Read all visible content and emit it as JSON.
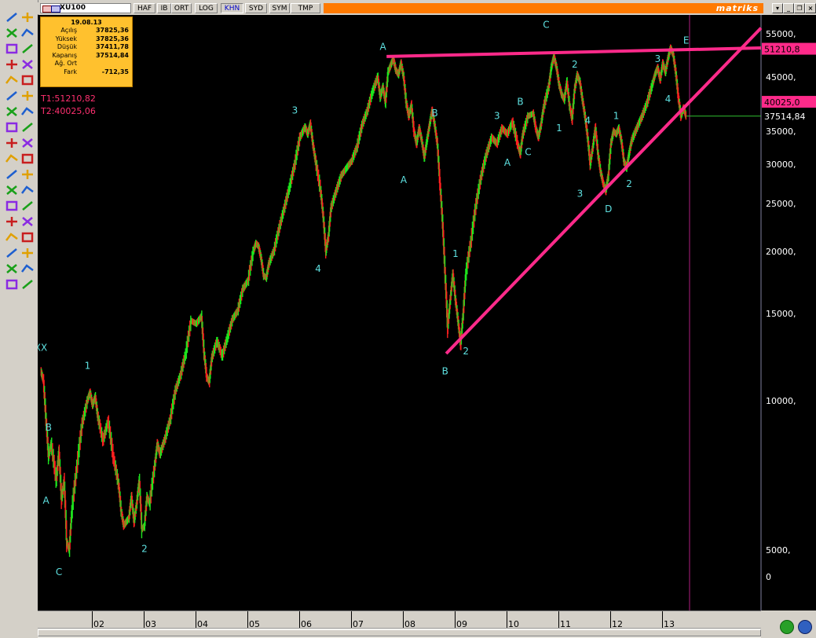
{
  "window": {
    "symbol": "XU100",
    "tabs": [
      "HAF",
      "IB",
      "ORT",
      "LOG",
      "KHN",
      "SYD",
      "SYM",
      "TMP"
    ],
    "active_tab": "KHN",
    "brand": "matriks",
    "controls": [
      "▾",
      "_",
      "❐",
      "×"
    ]
  },
  "info_box": {
    "date": "19.08.13",
    "rows": [
      {
        "label": "Açılış",
        "value": "37825,36"
      },
      {
        "label": "Yüksek",
        "value": "37825,36"
      },
      {
        "label": "Düşük",
        "value": "37411,78"
      },
      {
        "label": "Kapanış",
        "value": "37514,84"
      },
      {
        "label": "Ağ. Ort",
        "value": ""
      },
      {
        "label": "Fark",
        "value": "-712,35"
      }
    ]
  },
  "trendline_labels": {
    "t1": "T1:51210,82",
    "t2": "T2:40025,06"
  },
  "colors": {
    "up_bar": "#1ee61e",
    "down_bar": "#ff2020",
    "trendline": "#ff2a8a",
    "wave_label": "#5ee0e0",
    "axis_text": "#ffffff",
    "background": "#000000",
    "orange_brand": "#ff7a00"
  },
  "chart_data": {
    "type": "line",
    "instrument": "XU100",
    "y_scale": "log",
    "y_ticks": [
      "55000,",
      "45000,",
      "40000,",
      "35000,",
      "30000,",
      "25000,",
      "20000,",
      "15000,",
      "10000,",
      "5000,",
      "0"
    ],
    "x_ticks": [
      "02",
      "03",
      "04",
      "05",
      "06",
      "07",
      "08",
      "09",
      "10",
      "11",
      "12",
      "13"
    ],
    "price_flags": {
      "t1": "51210,8",
      "t2": "40025,0",
      "last": "37514,84"
    },
    "series": [
      {
        "values": [
          [
            2001.0,
            11500
          ],
          [
            2001.05,
            11000
          ],
          [
            2001.1,
            9200
          ],
          [
            2001.15,
            7700
          ],
          [
            2001.2,
            8200
          ],
          [
            2001.3,
            6900
          ],
          [
            2001.35,
            7900
          ],
          [
            2001.4,
            6300
          ],
          [
            2001.45,
            6900
          ],
          [
            2001.5,
            5200
          ],
          [
            2001.55,
            5000
          ],
          [
            2001.6,
            6000
          ],
          [
            2001.7,
            7400
          ],
          [
            2001.8,
            9000
          ],
          [
            2001.9,
            10000
          ],
          [
            2001.95,
            10400
          ],
          [
            2002.0,
            9800
          ],
          [
            2002.05,
            10200
          ],
          [
            2002.1,
            9300
          ],
          [
            2002.2,
            8300
          ],
          [
            2002.3,
            9100
          ],
          [
            2002.4,
            7700
          ],
          [
            2002.5,
            6800
          ],
          [
            2002.55,
            6000
          ],
          [
            2002.6,
            5600
          ],
          [
            2002.7,
            5800
          ],
          [
            2002.75,
            6400
          ],
          [
            2002.8,
            5700
          ],
          [
            2002.85,
            6200
          ],
          [
            2002.9,
            6900
          ],
          [
            2002.95,
            5500
          ],
          [
            2003.0,
            5600
          ],
          [
            2003.05,
            6400
          ],
          [
            2003.1,
            6200
          ],
          [
            2003.2,
            7400
          ],
          [
            2003.25,
            8200
          ],
          [
            2003.3,
            7800
          ],
          [
            2003.4,
            8400
          ],
          [
            2003.5,
            9200
          ],
          [
            2003.6,
            10500
          ],
          [
            2003.7,
            11300
          ],
          [
            2003.8,
            12500
          ],
          [
            2003.9,
            14500
          ],
          [
            2004.0,
            14300
          ],
          [
            2004.1,
            14800
          ],
          [
            2004.15,
            12500
          ],
          [
            2004.2,
            11200
          ],
          [
            2004.25,
            10900
          ],
          [
            2004.3,
            12200
          ],
          [
            2004.4,
            13200
          ],
          [
            2004.5,
            12300
          ],
          [
            2004.6,
            13400
          ],
          [
            2004.7,
            14600
          ],
          [
            2004.8,
            15200
          ],
          [
            2004.9,
            16800
          ],
          [
            2005.0,
            17500
          ],
          [
            2005.1,
            20000
          ],
          [
            2005.15,
            20800
          ],
          [
            2005.2,
            20500
          ],
          [
            2005.25,
            19400
          ],
          [
            2005.3,
            17900
          ],
          [
            2005.35,
            17700
          ],
          [
            2005.4,
            18900
          ],
          [
            2005.5,
            20100
          ],
          [
            2005.6,
            22300
          ],
          [
            2005.7,
            24500
          ],
          [
            2005.8,
            27000
          ],
          [
            2005.9,
            30000
          ],
          [
            2006.0,
            34000
          ],
          [
            2006.1,
            35700
          ],
          [
            2006.15,
            34500
          ],
          [
            2006.2,
            36200
          ],
          [
            2006.25,
            33000
          ],
          [
            2006.3,
            30500
          ],
          [
            2006.4,
            26500
          ],
          [
            2006.45,
            23500
          ],
          [
            2006.5,
            20000
          ],
          [
            2006.55,
            21500
          ],
          [
            2006.6,
            24500
          ],
          [
            2006.7,
            26500
          ],
          [
            2006.8,
            28500
          ],
          [
            2006.9,
            29500
          ],
          [
            2007.0,
            30500
          ],
          [
            2007.1,
            32500
          ],
          [
            2007.2,
            36000
          ],
          [
            2007.3,
            38500
          ],
          [
            2007.4,
            42000
          ],
          [
            2007.5,
            45000
          ],
          [
            2007.55,
            41000
          ],
          [
            2007.6,
            43000
          ],
          [
            2007.65,
            40000
          ],
          [
            2007.7,
            46000
          ],
          [
            2007.75,
            47500
          ],
          [
            2007.8,
            49000
          ],
          [
            2007.85,
            46500
          ],
          [
            2007.9,
            45500
          ],
          [
            2007.95,
            48000
          ],
          [
            2008.0,
            45000
          ],
          [
            2008.05,
            40000
          ],
          [
            2008.1,
            37500
          ],
          [
            2008.15,
            39500
          ],
          [
            2008.2,
            35000
          ],
          [
            2008.25,
            33000
          ],
          [
            2008.3,
            35500
          ],
          [
            2008.35,
            33500
          ],
          [
            2008.4,
            31000
          ],
          [
            2008.45,
            33500
          ],
          [
            2008.5,
            36000
          ],
          [
            2008.55,
            38500
          ],
          [
            2008.6,
            36000
          ],
          [
            2008.65,
            33000
          ],
          [
            2008.7,
            27500
          ],
          [
            2008.75,
            23000
          ],
          [
            2008.8,
            18000
          ],
          [
            2008.85,
            14000
          ],
          [
            2008.9,
            16000
          ],
          [
            2008.95,
            18000
          ],
          [
            2009.0,
            16000
          ],
          [
            2009.05,
            14500
          ],
          [
            2009.1,
            13000
          ],
          [
            2009.15,
            15000
          ],
          [
            2009.2,
            18000
          ],
          [
            2009.3,
            21000
          ],
          [
            2009.4,
            25000
          ],
          [
            2009.5,
            28500
          ],
          [
            2009.6,
            31500
          ],
          [
            2009.7,
            34000
          ],
          [
            2009.8,
            33000
          ],
          [
            2009.9,
            35500
          ],
          [
            2010.0,
            34500
          ],
          [
            2010.1,
            36500
          ],
          [
            2010.2,
            33000
          ],
          [
            2010.25,
            31500
          ],
          [
            2010.3,
            34500
          ],
          [
            2010.4,
            37500
          ],
          [
            2010.5,
            38000
          ],
          [
            2010.55,
            35500
          ],
          [
            2010.6,
            34000
          ],
          [
            2010.65,
            36000
          ],
          [
            2010.7,
            39000
          ],
          [
            2010.8,
            43000
          ],
          [
            2010.85,
            47000
          ],
          [
            2010.9,
            49500
          ],
          [
            2010.95,
            47000
          ],
          [
            2011.0,
            43500
          ],
          [
            2011.05,
            41500
          ],
          [
            2011.1,
            40500
          ],
          [
            2011.15,
            44000
          ],
          [
            2011.2,
            39500
          ],
          [
            2011.25,
            37000
          ],
          [
            2011.3,
            42500
          ],
          [
            2011.35,
            45500
          ],
          [
            2011.4,
            44000
          ],
          [
            2011.45,
            40500
          ],
          [
            2011.5,
            37500
          ],
          [
            2011.55,
            34000
          ],
          [
            2011.6,
            30000
          ],
          [
            2011.65,
            32500
          ],
          [
            2011.7,
            35500
          ],
          [
            2011.75,
            31500
          ],
          [
            2011.8,
            29000
          ],
          [
            2011.85,
            27500
          ],
          [
            2011.9,
            26500
          ],
          [
            2011.95,
            28500
          ],
          [
            2012.0,
            33000
          ],
          [
            2012.05,
            35000
          ],
          [
            2012.1,
            34500
          ],
          [
            2012.15,
            35500
          ],
          [
            2012.2,
            33500
          ],
          [
            2012.25,
            30500
          ],
          [
            2012.3,
            29500
          ],
          [
            2012.35,
            31500
          ],
          [
            2012.4,
            33500
          ],
          [
            2012.5,
            35500
          ],
          [
            2012.6,
            37500
          ],
          [
            2012.7,
            40000
          ],
          [
            2012.8,
            43500
          ],
          [
            2012.85,
            45500
          ],
          [
            2012.9,
            47000
          ],
          [
            2012.95,
            44500
          ],
          [
            2013.0,
            48000
          ],
          [
            2013.05,
            46000
          ],
          [
            2013.1,
            49000
          ],
          [
            2013.15,
            51500
          ],
          [
            2013.2,
            50000
          ],
          [
            2013.25,
            46000
          ],
          [
            2013.3,
            41000
          ],
          [
            2013.35,
            37500
          ],
          [
            2013.4,
            39000
          ],
          [
            2013.45,
            37514.84
          ]
        ]
      }
    ],
    "wave_labels": [
      {
        "text": "XX",
        "x": 2001.0,
        "y": 12600
      },
      {
        "text": "B",
        "x": 2001.15,
        "y": 8700
      },
      {
        "text": "A",
        "x": 2001.1,
        "y": 6200
      },
      {
        "text": "C",
        "x": 2001.35,
        "y": 4450
      },
      {
        "text": "1",
        "x": 2001.9,
        "y": 11600
      },
      {
        "text": "2",
        "x": 2003.0,
        "y": 4950
      },
      {
        "text": "3",
        "x": 2005.9,
        "y": 38000
      },
      {
        "text": "4",
        "x": 2006.35,
        "y": 18200
      },
      {
        "text": "A",
        "x": 2007.6,
        "y": 51000
      },
      {
        "text": "A",
        "x": 2008.0,
        "y": 27500
      },
      {
        "text": "B",
        "x": 2008.6,
        "y": 37500
      },
      {
        "text": "B",
        "x": 2008.8,
        "y": 11300
      },
      {
        "text": "1",
        "x": 2009.0,
        "y": 19500
      },
      {
        "text": "2",
        "x": 2009.2,
        "y": 12400
      },
      {
        "text": "3",
        "x": 2009.8,
        "y": 37000
      },
      {
        "text": "A",
        "x": 2010.0,
        "y": 29800
      },
      {
        "text": "B",
        "x": 2010.25,
        "y": 39500
      },
      {
        "text": "C",
        "x": 2010.4,
        "y": 31300
      },
      {
        "text": "C",
        "x": 2010.75,
        "y": 56500
      },
      {
        "text": "1",
        "x": 2011.0,
        "y": 35000
      },
      {
        "text": "2",
        "x": 2011.3,
        "y": 47000
      },
      {
        "text": "3",
        "x": 2011.4,
        "y": 25800
      },
      {
        "text": "4",
        "x": 2011.55,
        "y": 36200
      },
      {
        "text": "D",
        "x": 2011.95,
        "y": 24000
      },
      {
        "text": "1",
        "x": 2012.1,
        "y": 37000
      },
      {
        "text": "2",
        "x": 2012.35,
        "y": 27000
      },
      {
        "text": "3",
        "x": 2012.9,
        "y": 48200
      },
      {
        "text": "4",
        "x": 2013.1,
        "y": 40000
      },
      {
        "text": "E",
        "x": 2013.45,
        "y": 52500
      }
    ],
    "xlabel": "",
    "ylabel": ""
  }
}
